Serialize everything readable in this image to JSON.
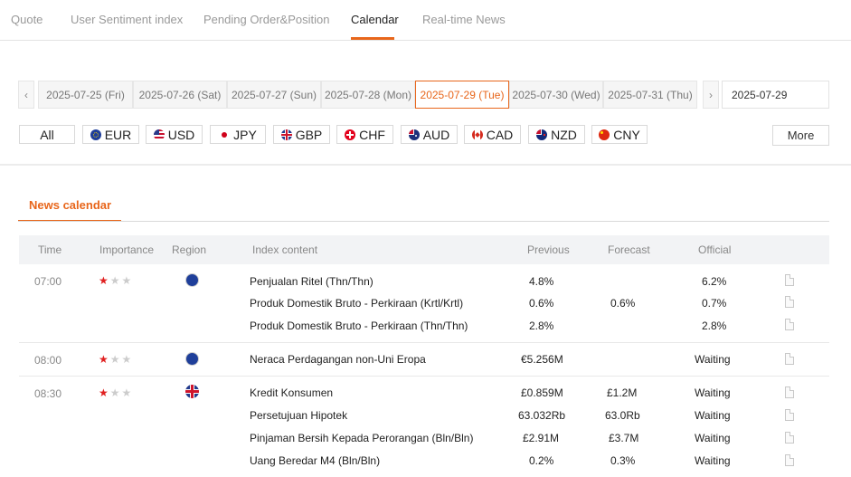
{
  "topnav": {
    "tabs": [
      {
        "label": "Quote"
      },
      {
        "label": "User Sentiment index"
      },
      {
        "label": "Pending Order&Position"
      },
      {
        "label": "Calendar"
      },
      {
        "label": "Real-time News"
      }
    ],
    "active": "Calendar"
  },
  "datestrip": {
    "prev": "‹",
    "next": "›",
    "dates": [
      {
        "label": "2025-07-25 (Fri)"
      },
      {
        "label": "2025-07-26 (Sat)"
      },
      {
        "label": "2025-07-27 (Sun)"
      },
      {
        "label": "2025-07-28 (Mon)"
      },
      {
        "label": "2025-07-29 (Tue)"
      },
      {
        "label": "2025-07-30 (Wed)"
      },
      {
        "label": "2025-07-31 (Thu)"
      }
    ],
    "selected": "2025-07-29 (Tue)",
    "picker_value": "2025-07-29"
  },
  "currencies": {
    "items": [
      {
        "label": "All",
        "icon": ""
      },
      {
        "label": "EUR",
        "icon": "eu-flag-icon"
      },
      {
        "label": "USD",
        "icon": "us-flag-icon"
      },
      {
        "label": "JPY",
        "icon": "jp-flag-icon"
      },
      {
        "label": "GBP",
        "icon": "gb-flag-icon"
      },
      {
        "label": "CHF",
        "icon": "ch-flag-icon"
      },
      {
        "label": "AUD",
        "icon": "au-flag-icon"
      },
      {
        "label": "CAD",
        "icon": "ca-flag-icon"
      },
      {
        "label": "NZD",
        "icon": "nz-flag-icon"
      },
      {
        "label": "CNY",
        "icon": "cn-flag-icon"
      }
    ],
    "more_label": "More"
  },
  "news": {
    "title": "News calendar",
    "headers": {
      "time": "Time",
      "importance": "Importance",
      "region": "Region",
      "index": "Index content",
      "previous": "Previous",
      "forecast": "Forecast",
      "official": "Official"
    },
    "groups": [
      {
        "time": "07:00",
        "importance": 1,
        "region_icon": "eu-flag-icon",
        "rows": [
          {
            "index": "Penjualan Ritel (Thn/Thn)",
            "previous": "4.8%",
            "forecast": "",
            "official": "6.2%"
          },
          {
            "index": "Produk Domestik Bruto - Perkiraan (Krtl/Krtl)",
            "previous": "0.6%",
            "forecast": "0.6%",
            "official": "0.7%"
          },
          {
            "index": "Produk Domestik Bruto - Perkiraan (Thn/Thn)",
            "previous": "2.8%",
            "forecast": "",
            "official": "2.8%"
          }
        ]
      },
      {
        "time": "08:00",
        "importance": 1,
        "region_icon": "eu-flag-icon",
        "rows": [
          {
            "index": "Neraca Perdagangan non-Uni Eropa",
            "previous": "€5.256M",
            "forecast": "",
            "official": "Waiting"
          }
        ]
      },
      {
        "time": "08:30",
        "importance": 1,
        "region_icon": "gb-flag-icon",
        "rows": [
          {
            "index": "Kredit Konsumen",
            "previous": "£0.859M",
            "forecast": "£1.2M",
            "official": "Waiting"
          },
          {
            "index": "Persetujuan Hipotek",
            "previous": "63.032Rb",
            "forecast": "63.0Rb",
            "official": "Waiting"
          },
          {
            "index": "Pinjaman Bersih Kepada Perorangan (Bln/Bln)",
            "previous": "£2.91M",
            "forecast": "£3.7M",
            "official": "Waiting"
          },
          {
            "index": "Uang Beredar M4 (Bln/Bln)",
            "previous": "0.2%",
            "forecast": "0.3%",
            "official": "Waiting"
          }
        ]
      }
    ]
  },
  "colors": {
    "accent": "#e8661b",
    "star_on": "#e02020"
  }
}
